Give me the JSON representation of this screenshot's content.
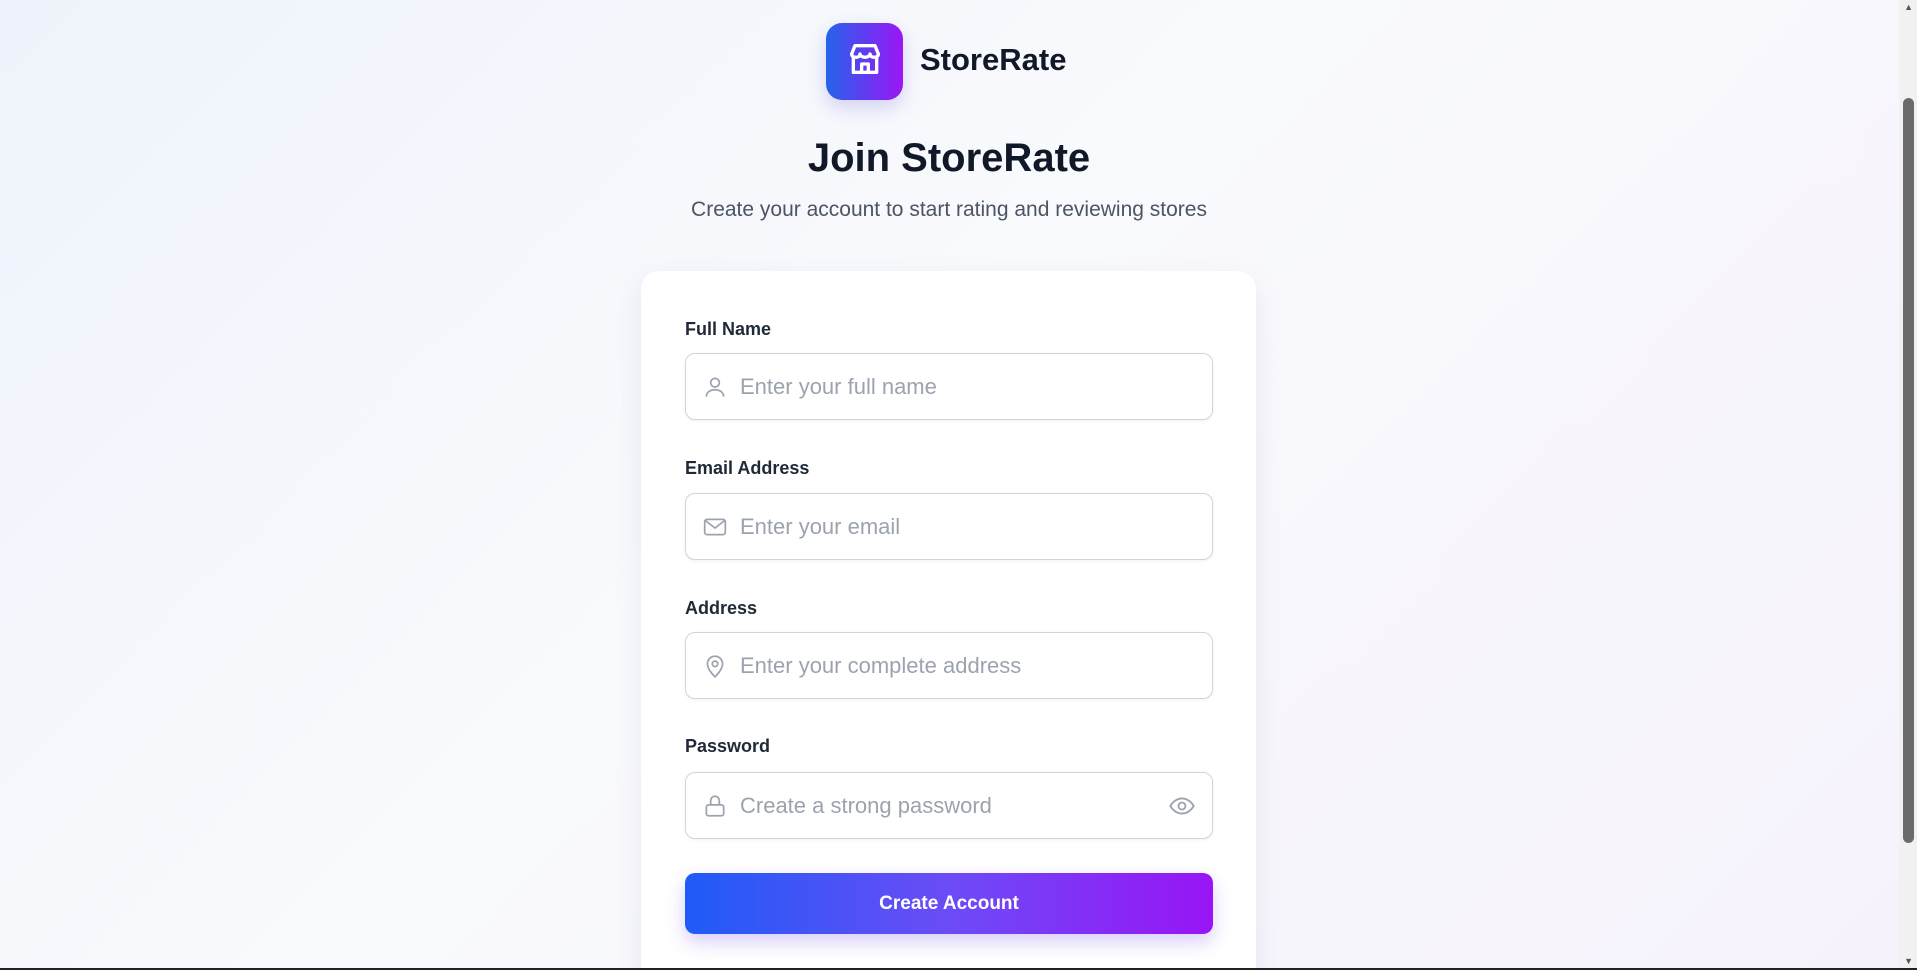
{
  "brand": {
    "name": "StoreRate",
    "icon": "store-icon"
  },
  "header": {
    "title": "Join StoreRate",
    "subtitle": "Create your account to start rating and reviewing stores"
  },
  "form": {
    "full_name": {
      "label": "Full Name",
      "placeholder": "Enter your full name",
      "icon": "user-icon"
    },
    "email": {
      "label": "Email Address",
      "placeholder": "Enter your email",
      "icon": "mail-icon"
    },
    "address": {
      "label": "Address",
      "placeholder": "Enter your complete address",
      "icon": "map-pin-icon"
    },
    "password": {
      "label": "Password",
      "placeholder": "Create a strong password",
      "icon": "lock-icon"
    },
    "submit_label": "Create Account"
  },
  "colors": {
    "gradient_start": "#1f5bf7",
    "gradient_end": "#9914f5"
  }
}
